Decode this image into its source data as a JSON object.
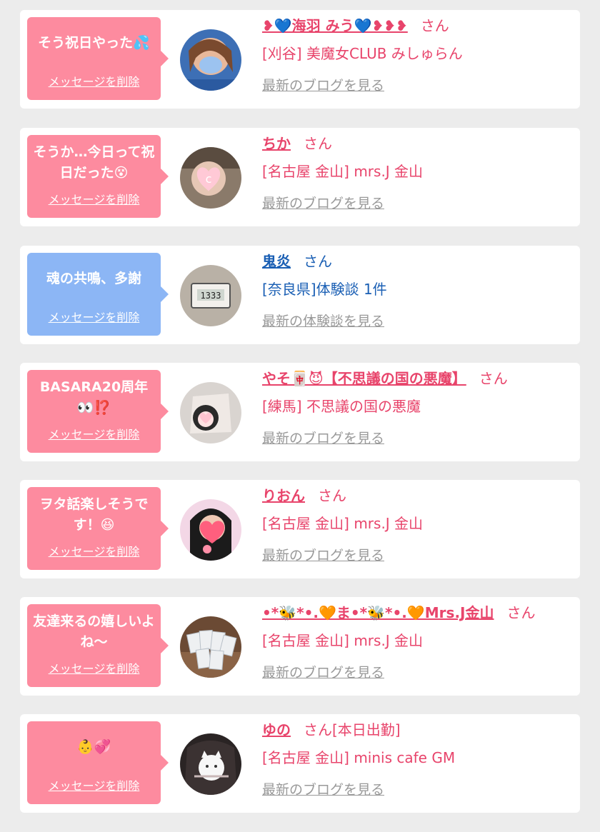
{
  "delete_label": "メッセージを削除",
  "san_label": "さん",
  "colors": {
    "pink_bubble": "#fd8b9f",
    "blue_bubble": "#8cb6f5",
    "pink_text": "#e8446b",
    "blue_text": "#1a5fb4"
  },
  "items": [
    {
      "bubble_color": "pink",
      "message": "そう祝日やった💦",
      "name": "❥💙海羽 みう💙❥❥❥",
      "san": "さん",
      "shop": "[刈谷] 美魔女CLUB みしゅらん",
      "link": "最新のブログを見る",
      "avatar_icon": "girl-photo"
    },
    {
      "bubble_color": "pink",
      "message": "そうか…今日って祝日だった😵",
      "name": "ちか",
      "san": "さん",
      "shop": "[名古屋 金山] mrs.J 金山",
      "link": "最新のブログを見る",
      "avatar_icon": "heart-photo"
    },
    {
      "bubble_color": "blue",
      "message": "魂の共鳴、多謝",
      "name": "鬼炎",
      "san": "さん",
      "shop": "[奈良県]体験談 1件",
      "link": "最新の体験談を見る",
      "avatar_icon": "clock-photo"
    },
    {
      "bubble_color": "pink",
      "message": "BASARA20周年👀⁉️",
      "name": "やそ🀄😈【不思議の国の悪魔】",
      "san": "さん",
      "shop": "[練馬] 不思議の国の悪魔",
      "link": "最新のブログを見る",
      "avatar_icon": "girl-photo"
    },
    {
      "bubble_color": "pink",
      "message": "ヲタ話楽しそうです！😆",
      "name": "りおん",
      "san": "さん",
      "shop": "[名古屋 金山] mrs.J 金山",
      "link": "最新のブログを見る",
      "avatar_icon": "heart-photo"
    },
    {
      "bubble_color": "pink",
      "message": "友達来るの嬉しいよね〜",
      "name": "•*🐝*•.🧡ま•*🐝*•.🧡Mrs.J金山",
      "san": "さん",
      "shop": "[名古屋 金山] mrs.J 金山",
      "link": "最新のブログを見る",
      "avatar_icon": "cards-photo"
    },
    {
      "bubble_color": "pink",
      "message": "👶💞",
      "name": "ゆの",
      "san": "さん[本日出勤]",
      "shop": "[名古屋 金山] minis cafe GM",
      "link": "最新のブログを見る",
      "avatar_icon": "cat-photo"
    }
  ]
}
